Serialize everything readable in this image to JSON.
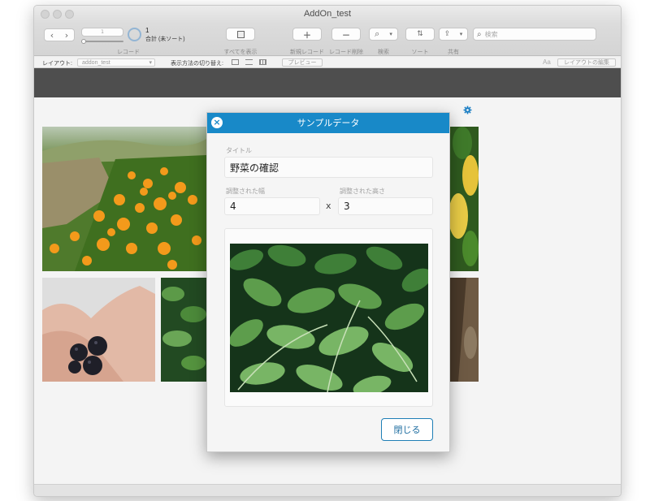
{
  "window": {
    "title": "AddOn_test"
  },
  "toolbar": {
    "record_number": "1",
    "record_current": "1",
    "record_total": "合計 (未ソート)",
    "label_records": "レコード",
    "label_show_all": "すべてを表示",
    "label_new_record": "新規レコード",
    "label_delete_record": "レコード削除",
    "label_find": "検索",
    "label_sort": "ソート",
    "label_share": "共有",
    "search_placeholder": "検索"
  },
  "subbar": {
    "layout_label": "レイアウト:",
    "layout_value": "addon_test",
    "view_switch_label": "表示方法の切り替え:",
    "preview_label": "プレビュー",
    "edit_layout_label": "レイアウトの編集",
    "font_glyph": "Aa"
  },
  "dialog": {
    "title": "サンプルデータ",
    "title_label": "タイトル",
    "title_value": "野菜の確認",
    "width_label": "調整された幅",
    "width_value": "4",
    "height_label": "調整された高さ",
    "height_value": "3",
    "times_symbol": "x",
    "close_label": "閉じる"
  },
  "colors": {
    "accent": "#1889c8",
    "dark_band": "#4e4e4e"
  },
  "icons": [
    "chevron-left-icon",
    "chevron-right-icon",
    "pie-icon",
    "show-all-icon",
    "plus-icon",
    "minus-icon",
    "magnifier-icon",
    "sort-icon",
    "share-icon",
    "gear-icon",
    "close-icon"
  ]
}
